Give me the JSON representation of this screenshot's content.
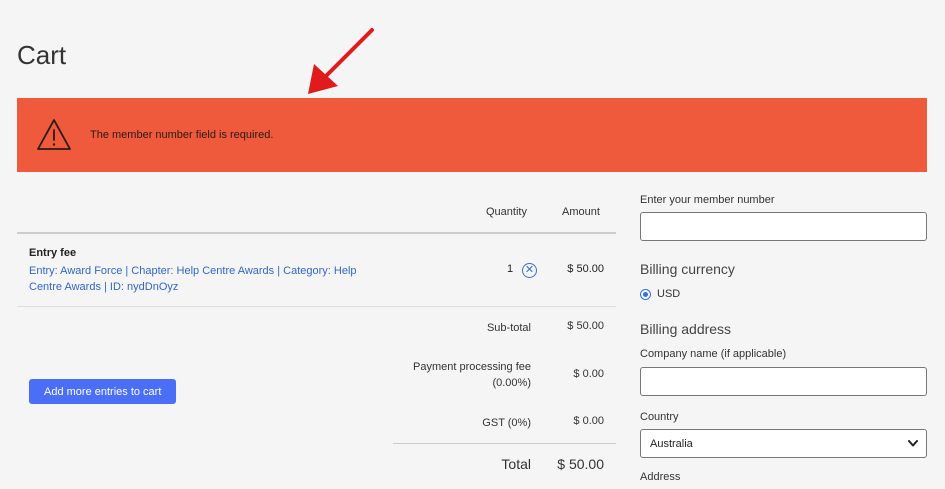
{
  "page": {
    "title": "Cart"
  },
  "alert": {
    "message": "The member number field is required.",
    "color": "#ef5a3c",
    "icon": "warning-triangle-icon"
  },
  "annotation": {
    "icon": "red-arrow-icon",
    "color": "#e01b1b"
  },
  "cart": {
    "headers": {
      "quantity": "Quantity",
      "amount": "Amount"
    },
    "item": {
      "title": "Entry fee",
      "description": "Entry: Award Force | Chapter: Help Centre Awards | Category: Help Centre Awards | ID: nydDnOyz",
      "quantity": "1",
      "amount": "$ 50.00",
      "remove_icon": "remove-circle-x-icon"
    },
    "summary": {
      "subtotal_label": "Sub-total",
      "subtotal_value": "$ 50.00",
      "fee_label": "Payment processing fee (0.00%)",
      "fee_value": "$ 0.00",
      "gst_label": "GST (0%)",
      "gst_value": "$ 0.00",
      "total_label": "Total",
      "total_value": "$ 50.00"
    },
    "add_button": "Add more entries to cart"
  },
  "form": {
    "member_label": "Enter your member number",
    "member_value": "",
    "currency_title": "Billing currency",
    "currency_option": "USD",
    "billing_title": "Billing address",
    "company_label": "Company name (if applicable)",
    "company_value": "",
    "country_label": "Country",
    "country_value": "Australia",
    "address_label": "Address"
  },
  "colors": {
    "link": "#3366cc",
    "button": "#4a6ef5"
  }
}
